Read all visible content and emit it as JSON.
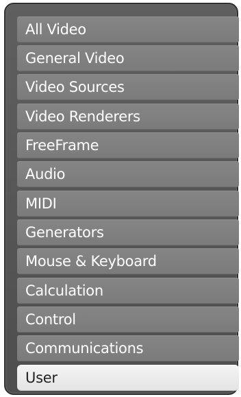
{
  "categories": [
    {
      "label": "All Video",
      "selected": false
    },
    {
      "label": "General Video",
      "selected": false
    },
    {
      "label": "Video Sources",
      "selected": false
    },
    {
      "label": "Video Renderers",
      "selected": false
    },
    {
      "label": "FreeFrame",
      "selected": false
    },
    {
      "label": "Audio",
      "selected": false
    },
    {
      "label": "MIDI",
      "selected": false
    },
    {
      "label": "Generators",
      "selected": false
    },
    {
      "label": "Mouse & Keyboard",
      "selected": false
    },
    {
      "label": "Calculation",
      "selected": false
    },
    {
      "label": "Control",
      "selected": false
    },
    {
      "label": "Communications",
      "selected": false
    },
    {
      "label": "User",
      "selected": true
    }
  ],
  "colors": {
    "panel": "#555555",
    "item": "#808080",
    "item_text": "#ffffff",
    "selected_item": "#eeeeee",
    "selected_text": "#222222"
  }
}
